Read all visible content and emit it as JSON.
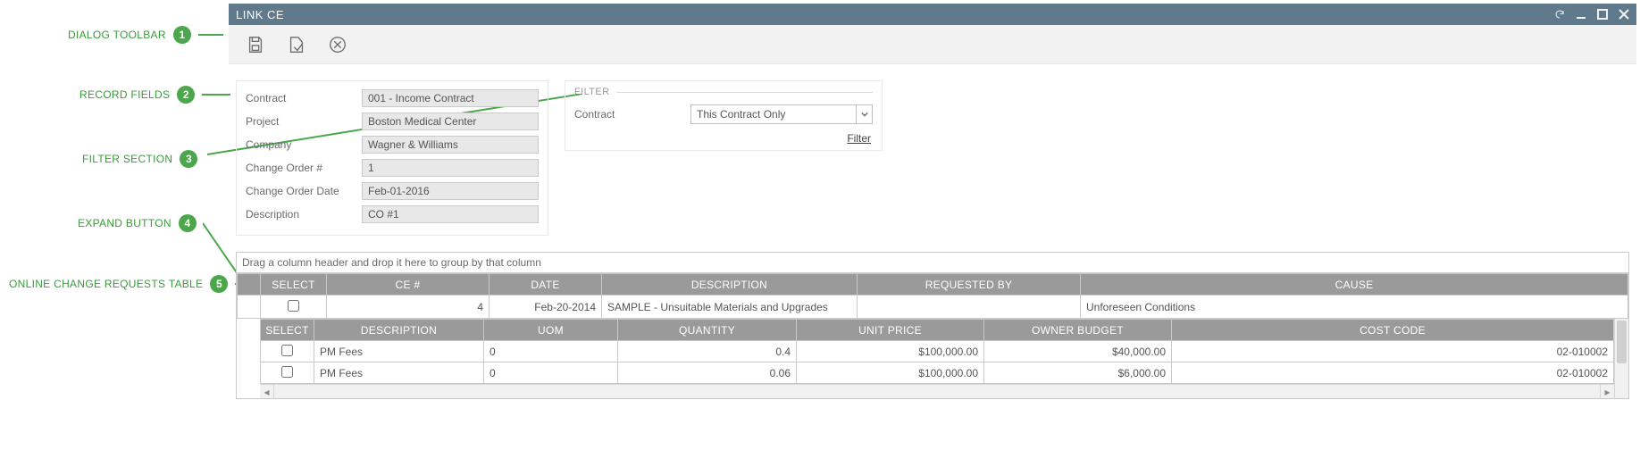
{
  "callouts": {
    "dialog_toolbar": "DIALOG TOOLBAR",
    "record_fields": "RECORD FIELDS",
    "filter_section": "FILTER SECTION",
    "expand_button": "EXPAND BUTTON",
    "online_change_requests_table": "ONLINE CHANGE REQUESTS TABLE"
  },
  "badges": {
    "b1": "1",
    "b2": "2",
    "b3": "3",
    "b4": "4",
    "b5": "5"
  },
  "window": {
    "title": "LINK CE"
  },
  "record": {
    "contract_label": "Contract",
    "contract_value": "001 - Income Contract",
    "project_label": "Project",
    "project_value": "Boston Medical Center",
    "company_label": "Company",
    "company_value": "Wagner & Williams",
    "co_num_label": "Change Order #",
    "co_num_value": "1",
    "co_date_label": "Change Order Date",
    "co_date_value": "Feb-01-2016",
    "desc_label": "Description",
    "desc_value": "CO #1"
  },
  "filter": {
    "legend": "FILTER",
    "contract_label": "Contract",
    "combo_value": "This Contract Only",
    "link": "Filter"
  },
  "grid": {
    "group_hint": "Drag a column header and drop it here to group by that column",
    "headers": {
      "select": "SELECT",
      "ce": "CE #",
      "date": "DATE",
      "desc": "DESCRIPTION",
      "req": "REQUESTED BY",
      "cause": "CAUSE"
    },
    "row": {
      "ce": "4",
      "date": "Feb-20-2014",
      "desc": "SAMPLE - Unsuitable Materials and Upgrades",
      "req": "",
      "cause": "Unforeseen Conditions"
    },
    "sub_headers": {
      "select": "SELECT",
      "desc": "DESCRIPTION",
      "uom": "UOM",
      "qty": "QUANTITY",
      "price": "UNIT PRICE",
      "budget": "OWNER BUDGET",
      "code": "COST CODE"
    },
    "sub_rows": [
      {
        "desc": "PM Fees",
        "uom": "0",
        "qty": "0.4",
        "price": "$100,000.00",
        "budget": "$40,000.00",
        "code": "02-010002"
      },
      {
        "desc": "PM Fees",
        "uom": "0",
        "qty": "0.06",
        "price": "$100,000.00",
        "budget": "$6,000.00",
        "code": "02-010002"
      }
    ]
  }
}
